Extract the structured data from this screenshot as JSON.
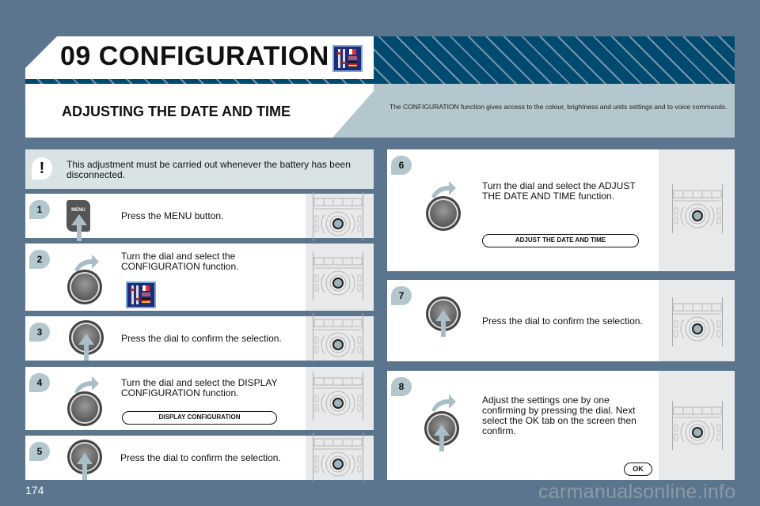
{
  "header": {
    "title": "09 CONFIGURATION",
    "icon": "configuration-icon",
    "subtitle": "ADJUSTING THE DATE AND TIME",
    "intro": "The CONFIGURATION function gives access to the colour, brightness and units settings and to voice commands."
  },
  "warning": {
    "badge": "!",
    "text": "This adjustment must be carried out whenever the battery has been disconnected."
  },
  "steps": [
    {
      "num": "1",
      "text": "Press the MENU button.",
      "icon": "menu-button-icon",
      "icon_label": "MENU"
    },
    {
      "num": "2",
      "text": "Turn the dial and select the CONFIGURATION function.",
      "icon": "dial-turn-icon"
    },
    {
      "num": "3",
      "text": "Press the dial to confirm the selection.",
      "icon": "dial-press-icon"
    },
    {
      "num": "4",
      "text": "Turn the dial and select the DISPLAY CONFIGURATION function.",
      "icon": "dial-turn-icon",
      "screen_label": "DISPLAY CONFIGURATION"
    },
    {
      "num": "5",
      "text": "Press the dial to confirm the selection.",
      "icon": "dial-press-icon"
    },
    {
      "num": "6",
      "text": "Turn the dial and select the ADJUST THE DATE AND TIME function.",
      "icon": "dial-turn-icon",
      "screen_label": "ADJUST THE DATE AND TIME"
    },
    {
      "num": "7",
      "text": "Press the dial to confirm the selection.",
      "icon": "dial-press-icon"
    },
    {
      "num": "8",
      "text": "Adjust the settings one by one confirming by pressing the dial. Next select the OK tab on the screen then confirm.",
      "icon": "dial-turn-press-icon",
      "screen_label": "OK"
    }
  ],
  "footer": {
    "page_number": "174",
    "watermark": "carmanualsonline.info"
  },
  "colors": {
    "background": "#5a758d",
    "stripe_dark": "#004a70",
    "light_band": "#b4c7ce",
    "warning_bg": "#d9e3e6"
  }
}
